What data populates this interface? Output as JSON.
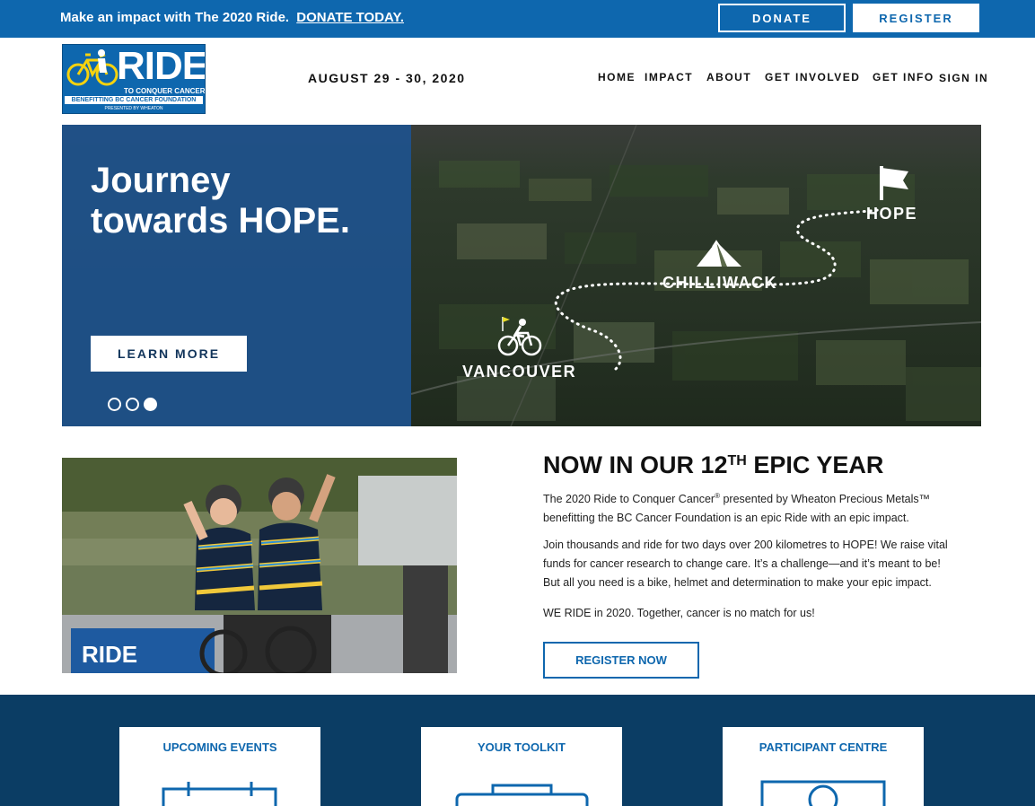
{
  "topbar": {
    "text": "Make an impact with The 2020 Ride.",
    "link": "DONATE TODAY.",
    "donate_label": "DONATE",
    "register_label": "REGISTER"
  },
  "logo": {
    "wordmark": "RIDE",
    "tagline": "TO CONQUER CANCER",
    "beneficiary": "BENEFITTING BC CANCER FOUNDATION",
    "presenter": "PRESENTED BY WHEATON"
  },
  "header": {
    "date": "AUGUST 29 - 30, 2020",
    "nav": [
      "HOME",
      "IMPACT",
      "ABOUT",
      "GET INVOLVED",
      "GET INFO",
      "SIGN IN"
    ]
  },
  "hero": {
    "title_line1": "Journey",
    "title_line2": "towards HOPE.",
    "button": "LEARN MORE",
    "slides_total": 3,
    "active_slide": 3,
    "route": {
      "start": "VANCOUVER",
      "mid": "CHILLIWACK",
      "end": "HOPE"
    }
  },
  "intro": {
    "heading_pre": "NOW IN OUR 12",
    "heading_sup": "TH",
    "heading_post": " EPIC YEAR",
    "p1_a": "The 2020 Ride to Conquer Cancer",
    "p1_sup": "®",
    "p1_b": " presented by Wheaton Precious Metals™ benefitting the BC Cancer Foundation is an epic Ride with an epic impact.",
    "p2": "Join thousands and ride for two days over 200 kilometres to HOPE! We raise vital funds for cancer research to change care. It’s a challenge—and it’s meant to be! But all you need is a bike, helmet and determination to make your epic impact.",
    "p3": "WE RIDE in 2020. Together, cancer is no match for us!",
    "button": "REGISTER NOW"
  },
  "cards": [
    {
      "title": "UPCOMING EVENTS",
      "icon": "calendar-icon"
    },
    {
      "title": "YOUR TOOLKIT",
      "icon": "toolkit-icon"
    },
    {
      "title": "PARTICIPANT CENTRE",
      "icon": "participant-icon"
    }
  ],
  "colors": {
    "brand_blue": "#0e67ae",
    "navy": "#0b3d64",
    "hero_panel": "#1e528c"
  }
}
